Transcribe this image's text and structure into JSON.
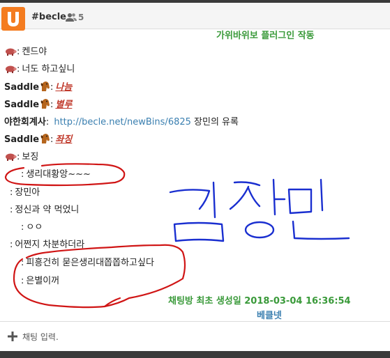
{
  "header": {
    "channel": "#becle",
    "user_count": "5",
    "logo_icon": "orange-u-logo-icon",
    "users_icon": "users-icon"
  },
  "notices": {
    "plugin": "가위바위보 플러그인 작동",
    "created": "채팅방 최초 생성일  2018-03-04  16:36:54",
    "brand": "베클넷"
  },
  "messages": [
    {
      "nick": "",
      "icon": "pig-icon",
      "text": "켄드야"
    },
    {
      "nick": "",
      "icon": "pig-icon",
      "text": "너도 하고싶니"
    },
    {
      "nick": "Saddle",
      "icon": "horse-icon",
      "text": "나늠",
      "style": "em"
    },
    {
      "nick": "Saddle",
      "icon": "horse-icon",
      "text": "별루",
      "style": "em"
    },
    {
      "nick": "야한회계사",
      "icon": "",
      "link": "http://becle.net/newBins/6825",
      "text": "장민의 유록"
    },
    {
      "nick": "Saddle",
      "icon": "horse-icon",
      "text": "좌징",
      "style": "em"
    },
    {
      "nick": "",
      "icon": "pig-icon",
      "text": "보징"
    },
    {
      "nick": "",
      "icon": "",
      "text": "생리대황앙~~~"
    },
    {
      "nick": "",
      "icon": "",
      "text": "장민아"
    },
    {
      "nick": "",
      "icon": "",
      "text": "정신과 약 먹었니"
    },
    {
      "nick": "",
      "icon": "",
      "text": "ㅇㅇ"
    },
    {
      "nick": "",
      "icon": "",
      "text": "어쩐지 차분하더라"
    },
    {
      "nick": "",
      "icon": "",
      "text": "피흥건히 묻은생리대쫍쫍하고싶다"
    },
    {
      "nick": "",
      "icon": "",
      "text": "은별이꺼"
    }
  ],
  "annotation": {
    "handwriting": "김장민",
    "handwriting_color": "#1a2fd0",
    "circle_color": "#d01515"
  },
  "input": {
    "placeholder": "채팅 입력.",
    "plus_icon": "plus-icon"
  },
  "colors": {
    "logo": "#f47c20",
    "notice_green": "#3a9a3a",
    "notice_blue": "#3a7fb0",
    "emphasis": "#c0392b",
    "link": "#3a7fb0"
  }
}
